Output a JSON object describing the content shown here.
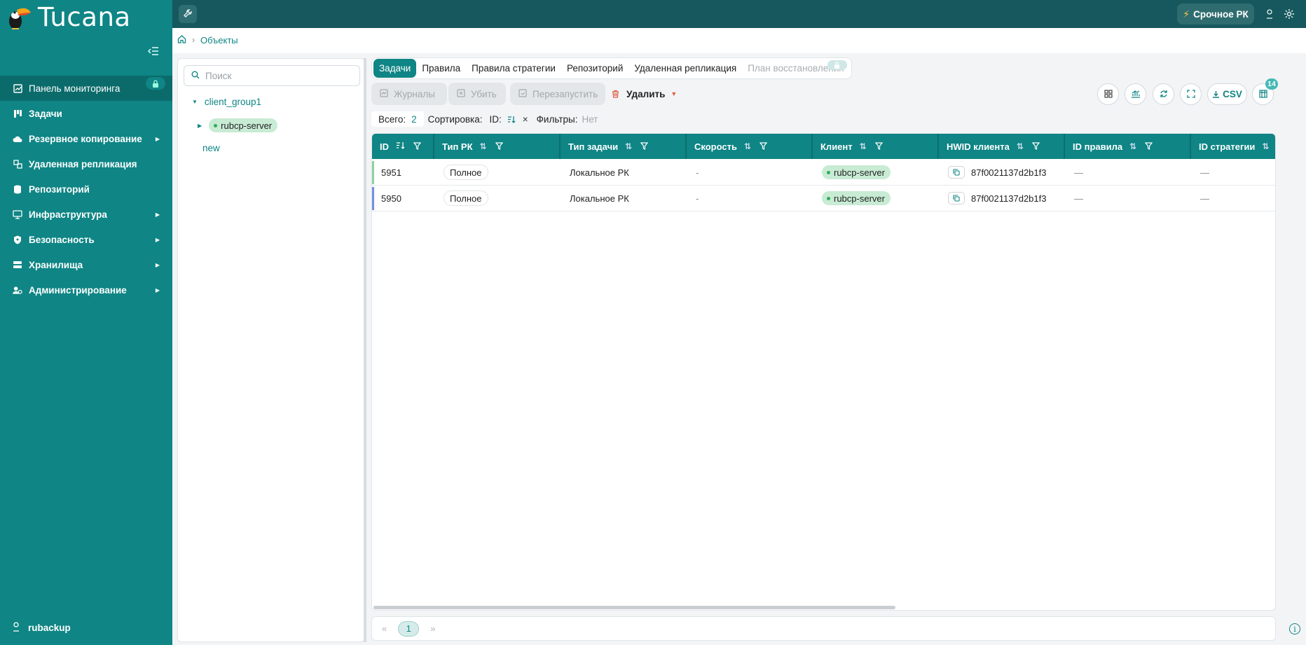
{
  "app": {
    "name": "Tucana"
  },
  "sidebar": {
    "items": [
      {
        "label": "Панель мониторинга"
      },
      {
        "label": "Задачи"
      },
      {
        "label": "Резервное копирование"
      },
      {
        "label": "Удаленная репликация"
      },
      {
        "label": "Репозиторий"
      },
      {
        "label": "Инфраструктура"
      },
      {
        "label": "Безопасность"
      },
      {
        "label": "Хранилища"
      },
      {
        "label": "Администрирование"
      }
    ],
    "user": "rubackup"
  },
  "topbar": {
    "urgent_label": "Срочное РК"
  },
  "breadcrumb": {
    "current": "Объекты"
  },
  "tree": {
    "search_placeholder": "Поиск",
    "group": "client_group1",
    "client": "rubcp-server",
    "new_label": "new"
  },
  "tabs": [
    {
      "label": "Задачи"
    },
    {
      "label": "Правила"
    },
    {
      "label": "Правила стратегии"
    },
    {
      "label": "Репозиторий"
    },
    {
      "label": "Удаленная репликация"
    },
    {
      "label": "План восстановления"
    }
  ],
  "toolbar": {
    "logs_label": "Журналы",
    "kill_label": "Убить",
    "restart_label": "Перезапустить",
    "delete_label": "Удалить",
    "csv_label": "CSV",
    "columns_count": "14"
  },
  "summary": {
    "total_label": "Всего:",
    "total_value": "2",
    "sort_label": "Сортировка:",
    "sort_field": "ID:",
    "filters_label": "Фильтры:",
    "filters_value": "Нет"
  },
  "table": {
    "columns": [
      "ID",
      "Тип РК",
      "Тип задачи",
      "Скорость",
      "Клиент",
      "HWID клиента",
      "ID правила",
      "ID стратегии"
    ],
    "rows": [
      {
        "id": "5951",
        "type": "Полное",
        "task_type": "Локальное РК",
        "speed": "-",
        "client": "rubcp-server",
        "hwid": "87f0021137d2b1f3",
        "rule_id": "—",
        "strategy_id": "—"
      },
      {
        "id": "5950",
        "type": "Полное",
        "task_type": "Локальное РК",
        "speed": "-",
        "client": "rubcp-server",
        "hwid": "87f0021137d2b1f3",
        "rule_id": "—",
        "strategy_id": "—"
      }
    ]
  },
  "pager": {
    "prev": "«",
    "page": "1",
    "next": "»"
  },
  "colors": {
    "accent": "#0f8585",
    "topbar": "#16585d",
    "chip": "#c8ebd4",
    "danger": "#e05a47"
  },
  "icons": [
    "toucan-logo-icon",
    "collapse-menu-icon",
    "dashboard-icon",
    "tasks-icon",
    "cloud-backup-icon",
    "replication-icon",
    "repository-icon",
    "infrastructure-icon",
    "shield-icon",
    "storage-icon",
    "admin-icon",
    "lock-icon",
    "user-icon",
    "wrench-icon",
    "bolt-icon",
    "gear-icon",
    "home-icon",
    "search-icon",
    "trash-icon",
    "grid-icon",
    "chart-icon",
    "refresh-icon",
    "fullscreen-icon",
    "download-icon",
    "columns-icon",
    "sort-icon",
    "filter-icon",
    "copy-icon",
    "info-icon"
  ]
}
